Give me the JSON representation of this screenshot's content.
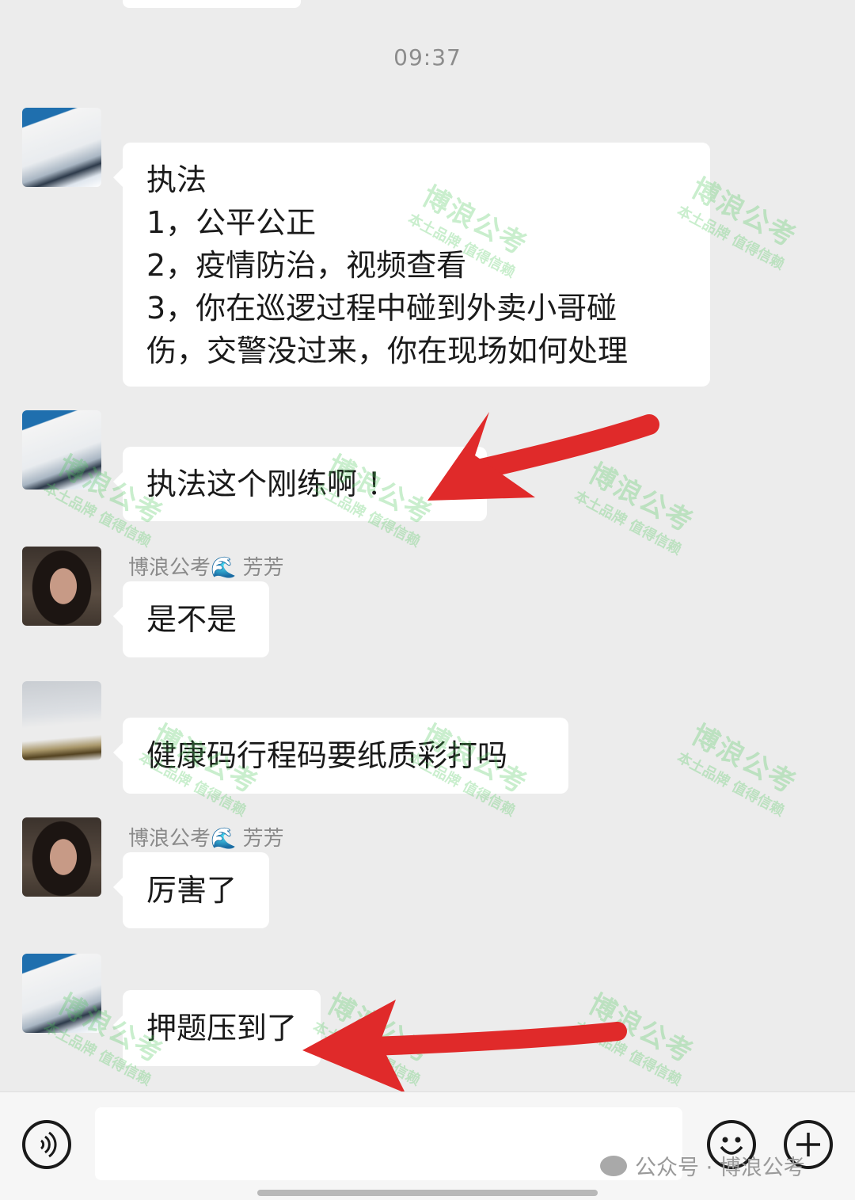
{
  "timestamp": "09:37",
  "messages": [
    {
      "sender": "",
      "lines": [
        "执法",
        "1，公平公正",
        "2，疫情防治，视频查看",
        "3，你在巡逻过程中碰到外卖小哥碰",
        "伤，交警没过来，你在现场如何处理"
      ]
    },
    {
      "sender": "",
      "lines": [
        "执法这个刚练啊 ！"
      ]
    },
    {
      "sender": "博浪公考🌊 芳芳",
      "lines": [
        "是不是"
      ]
    },
    {
      "sender": "",
      "lines": [
        "健康码行程码要纸质彩打吗"
      ]
    },
    {
      "sender": "博浪公考🌊 芳芳",
      "lines": [
        "厉害了"
      ]
    },
    {
      "sender": "",
      "lines": [
        "押题压到了"
      ]
    }
  ],
  "watermark": {
    "main": "博浪公考",
    "sub": "本土品牌 值得信赖"
  },
  "footer_watermark": "公众号 · 博浪公考",
  "annotation_color": "#e02a2a",
  "input_bar": {
    "voice_icon": "voice-icon",
    "emoji_icon": "emoji-icon",
    "plus_icon": "plus-icon"
  }
}
